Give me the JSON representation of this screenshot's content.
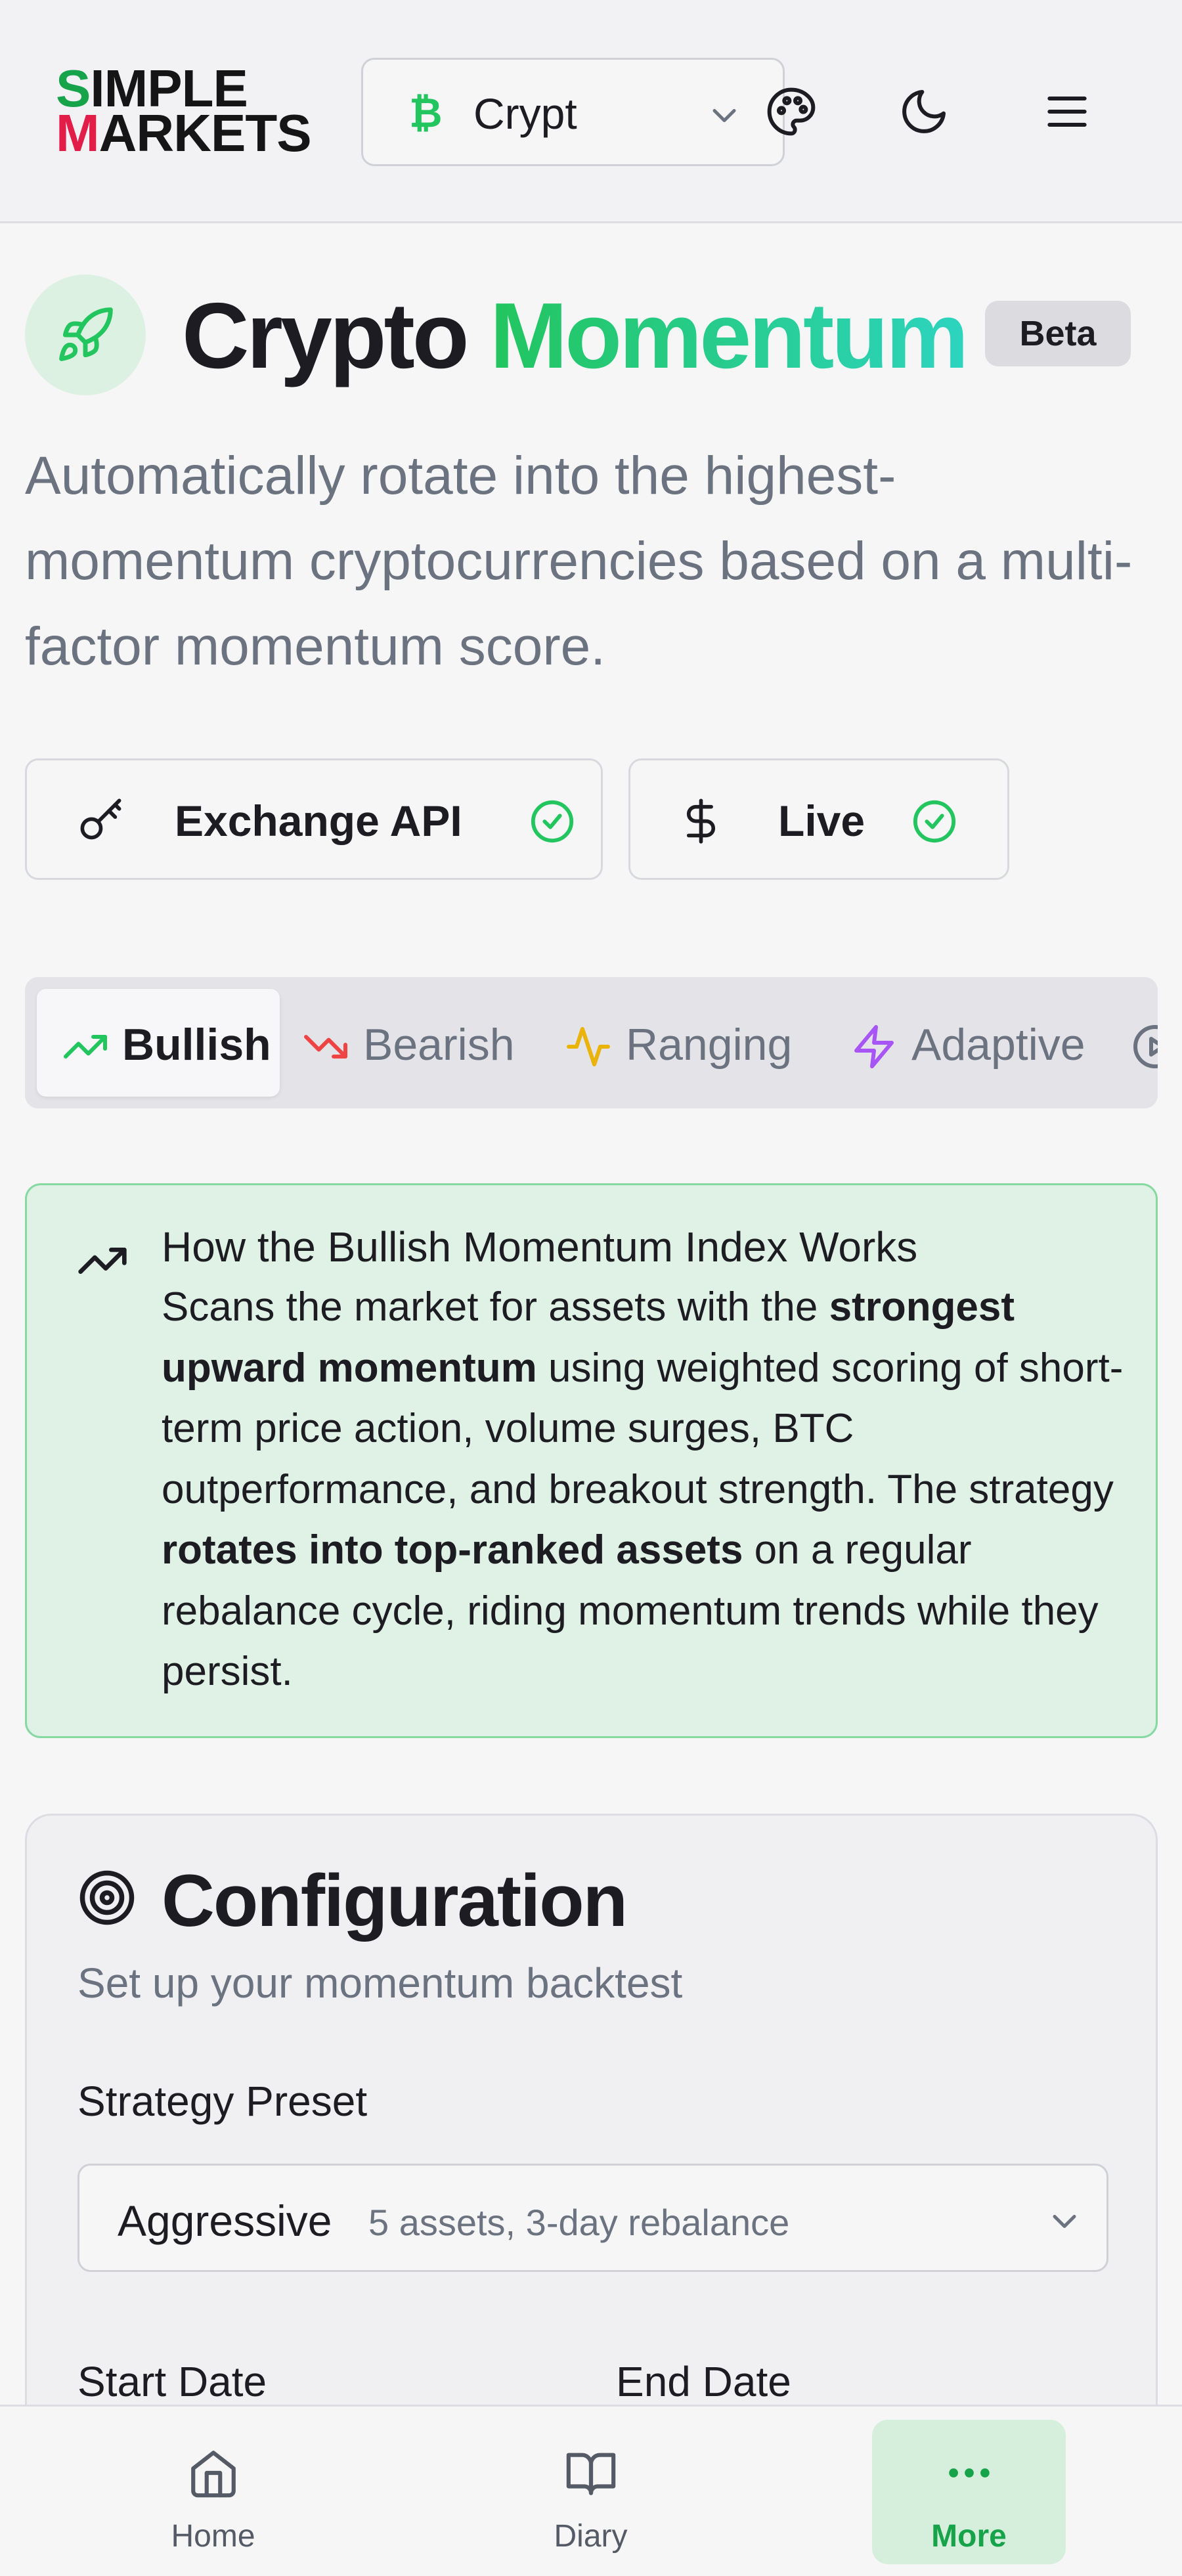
{
  "header": {
    "logo_line1": "SIMPLE",
    "logo_line2": "MARKETS",
    "asset_select_value": "Crypt",
    "asset_select_icon": "bitcoin-icon",
    "icons": [
      "palette-icon",
      "moon-icon",
      "menu-icon"
    ]
  },
  "title": {
    "word1": "Crypto",
    "word2": "Momentum",
    "badge": "Beta",
    "icon": "rocket-icon"
  },
  "description": "Automatically rotate into the highest-momentum cryptocurrencies based on a multi-factor momentum score.",
  "status_pills": [
    {
      "label": "Exchange API",
      "icon": "key-icon",
      "status": "check-circle-icon"
    },
    {
      "label": "Live",
      "icon": "dollar-icon",
      "status": "check-circle-icon"
    }
  ],
  "tabs": [
    {
      "label": "Bullish",
      "icon": "trending-up-icon",
      "color": "#22c55e",
      "active": true
    },
    {
      "label": "Bearish",
      "icon": "trending-down-icon",
      "color": "#ef4444",
      "active": false
    },
    {
      "label": "Ranging",
      "icon": "activity-icon",
      "color": "#eab308",
      "active": false
    },
    {
      "label": "Adaptive",
      "icon": "zap-icon",
      "color": "#a855f7",
      "active": false
    }
  ],
  "info": {
    "heading": "How the Bullish Momentum Index Works",
    "body_1": "Scans the market for assets with the ",
    "body_bold_1": "strongest upward momentum",
    "body_2": " using weighted scoring of short-term price action, volume surges, BTC outperformance, and breakout strength. The strategy ",
    "body_bold_2": "rotates into top-ranked assets",
    "body_3": " on a regular rebalance cycle, riding momentum trends while they persist."
  },
  "config": {
    "title": "Configuration",
    "subtitle": "Set up your momentum backtest",
    "preset_label": "Strategy Preset",
    "preset_value": "Aggressive",
    "preset_detail": "5 assets, 3-day rebalance",
    "start_date_label": "Start Date",
    "end_date_label": "End Date"
  },
  "bottom_nav": [
    {
      "label": "Home",
      "icon": "home-icon",
      "active": false
    },
    {
      "label": "Diary",
      "icon": "book-icon",
      "active": false
    },
    {
      "label": "More",
      "icon": "more-dots-icon",
      "active": true
    }
  ],
  "colors": {
    "accent": "#22c55e",
    "accent_dark": "#16a34a",
    "info_bg": "#e0f1e5",
    "info_border": "#86d9a1"
  }
}
